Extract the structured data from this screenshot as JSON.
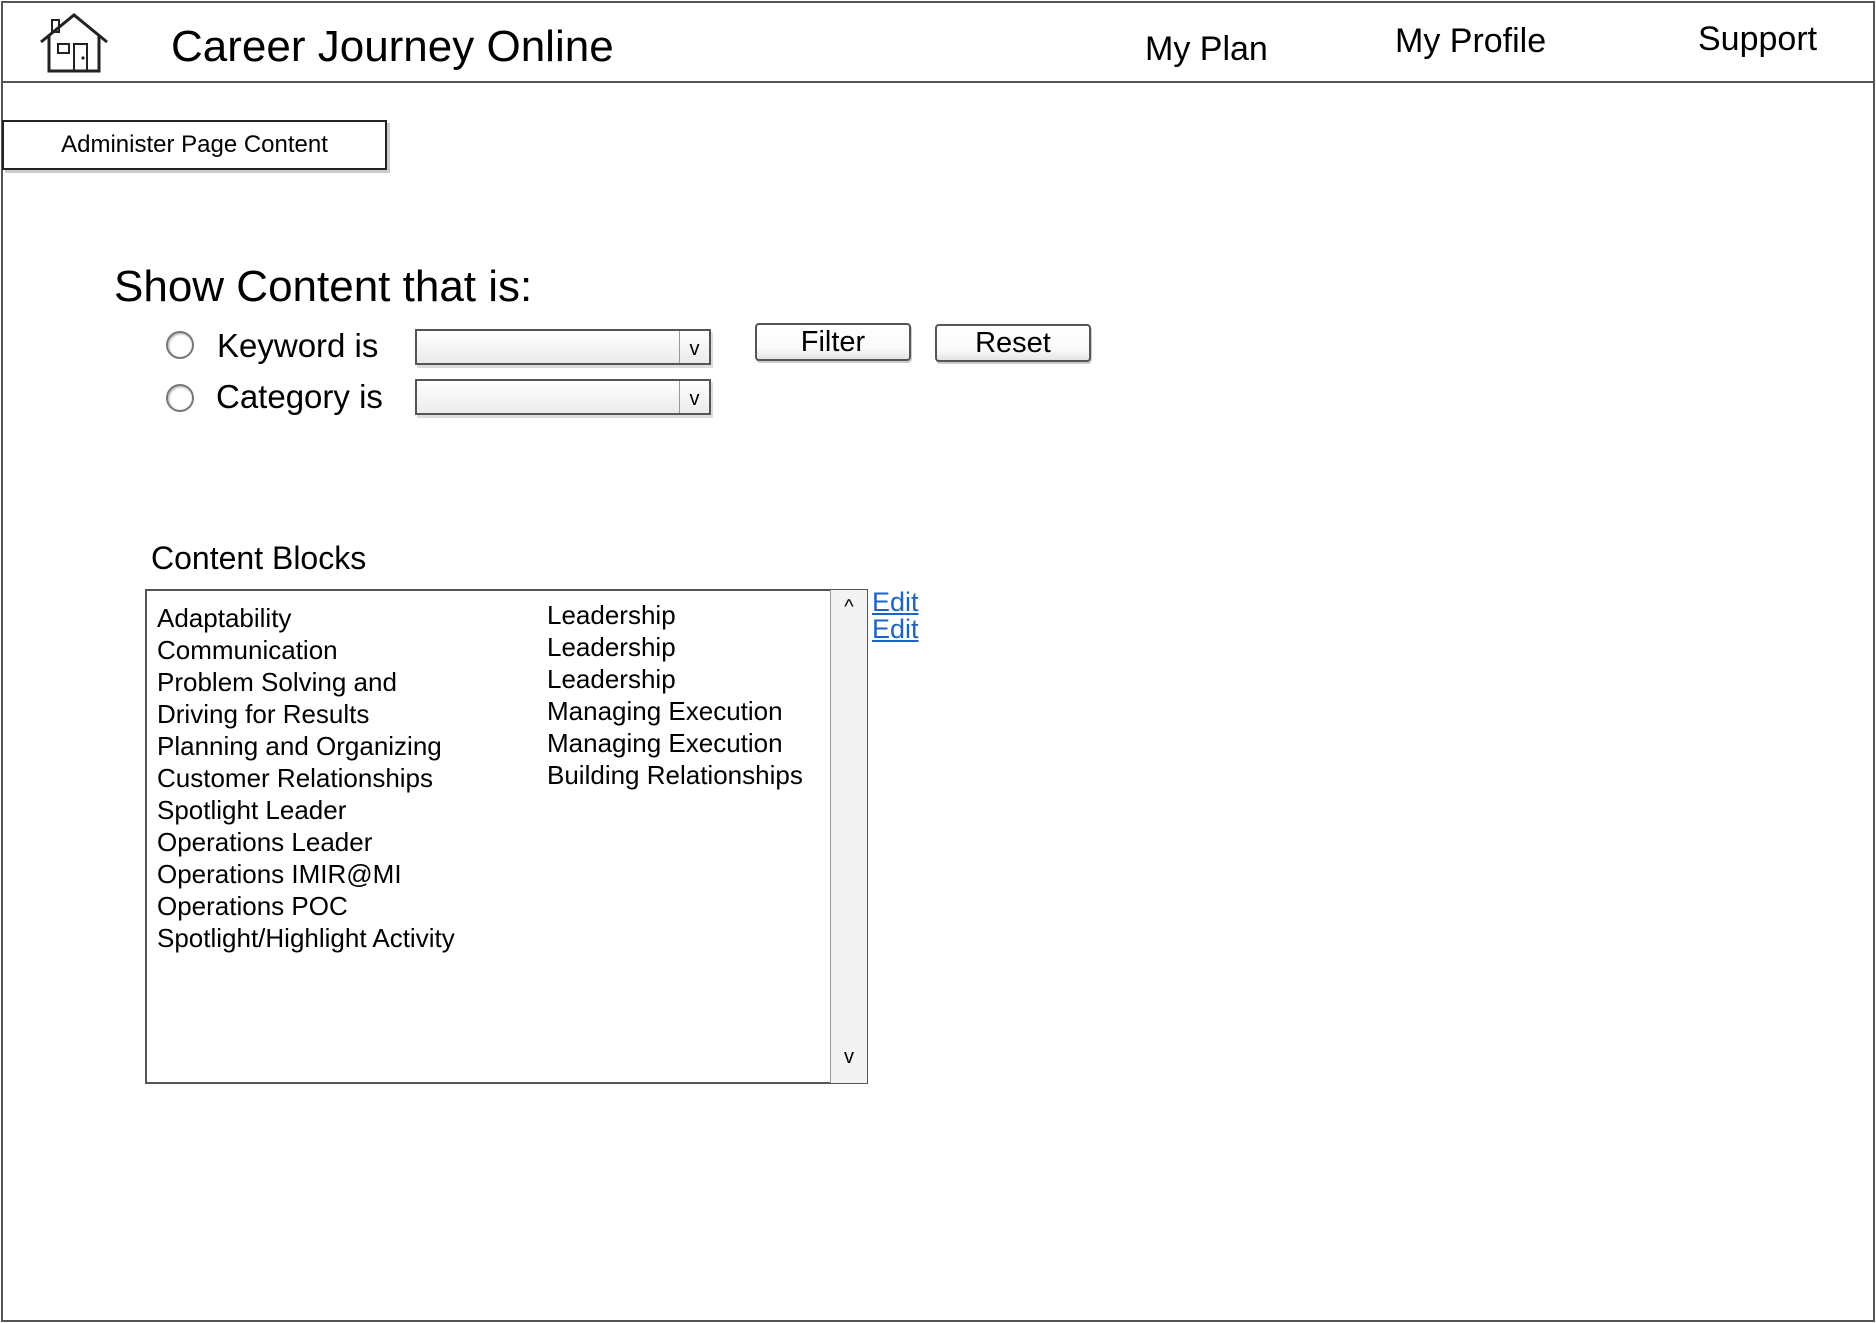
{
  "header": {
    "app_title": "Career Journey Online",
    "nav": [
      "My Plan",
      "My Profile",
      "Support"
    ]
  },
  "admin_button": "Administer Page Content",
  "filter": {
    "heading": "Show Content that is:",
    "keyword_label": "Keyword is",
    "category_label": "Category is",
    "keyword_value": "",
    "category_value": "",
    "dropdown_arrow": "v",
    "filter_button": "Filter",
    "reset_button": "Reset"
  },
  "content_blocks": {
    "heading": "Content Blocks",
    "names": [
      "Adaptability",
      "Communication",
      "Problem Solving and",
      "Driving for Results",
      "Planning and Organizing",
      "Customer Relationships",
      "Spotlight Leader",
      "Operations Leader",
      "Operations IMIR@MI",
      "Operations POC",
      "Spotlight/Highlight Activity"
    ],
    "categories": [
      "Leadership",
      "Leadership",
      "Leadership",
      "Managing Execution",
      "Managing Execution",
      "Building Relationships"
    ],
    "scroll_up": "^",
    "scroll_down": "v",
    "edit_links": [
      "Edit",
      "Edit"
    ]
  },
  "colors": {
    "link": "#1a63c7",
    "border": "#555555"
  },
  "icons": {
    "home": "home-icon"
  }
}
